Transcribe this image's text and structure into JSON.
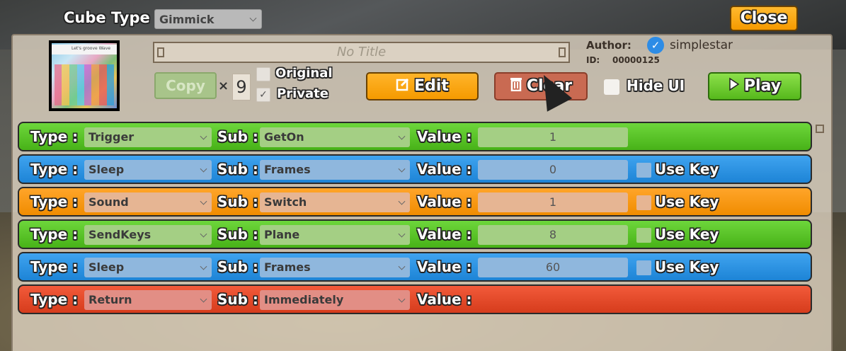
{
  "header": {
    "cube_type_label": "Cube Type",
    "cube_type_value": "Gimmick",
    "close_label": "Close"
  },
  "info": {
    "thumbnail_caption": "Let's groove Wave",
    "title_placeholder": "No Title",
    "author_label": "Author:",
    "author_name": "simplestar",
    "author_verified_icon": "check-circle-icon",
    "id_label": "ID:",
    "id_value": "00000125"
  },
  "actions": {
    "copy_label": "Copy",
    "times": "×",
    "copy_count": "9",
    "original_label": "Original",
    "original_checked": false,
    "private_label": "Private",
    "private_checked": true,
    "edit_label": "Edit",
    "clear_label": "Clear",
    "hide_ui_label": "Hide UI",
    "hide_ui_checked": false,
    "play_label": "Play"
  },
  "rows_common": {
    "type_label": "Type :",
    "sub_label": "Sub :",
    "value_label": "Value :",
    "use_key_label": "Use Key"
  },
  "rows": [
    {
      "color": "green",
      "type": "Trigger",
      "sub": "GetOn",
      "value": "1",
      "has_value": true,
      "has_use_key": false
    },
    {
      "color": "blue",
      "type": "Sleep",
      "sub": "Frames",
      "value": "0",
      "has_value": true,
      "has_use_key": true
    },
    {
      "color": "orange",
      "type": "Sound",
      "sub": "Switch",
      "value": "1",
      "has_value": true,
      "has_use_key": true
    },
    {
      "color": "green",
      "type": "SendKeys",
      "sub": "Plane",
      "value": "8",
      "has_value": true,
      "has_use_key": true
    },
    {
      "color": "blue",
      "type": "Sleep",
      "sub": "Frames",
      "value": "60",
      "has_value": true,
      "has_use_key": true
    },
    {
      "color": "red",
      "type": "Return",
      "sub": "Immediately",
      "value": "",
      "has_value": false,
      "has_use_key": false
    }
  ],
  "colors": {
    "green": "#48b218",
    "blue": "#1d84d6",
    "orange": "#f08c00",
    "red": "#d63c1c",
    "accent_orange": "#f59a00"
  }
}
